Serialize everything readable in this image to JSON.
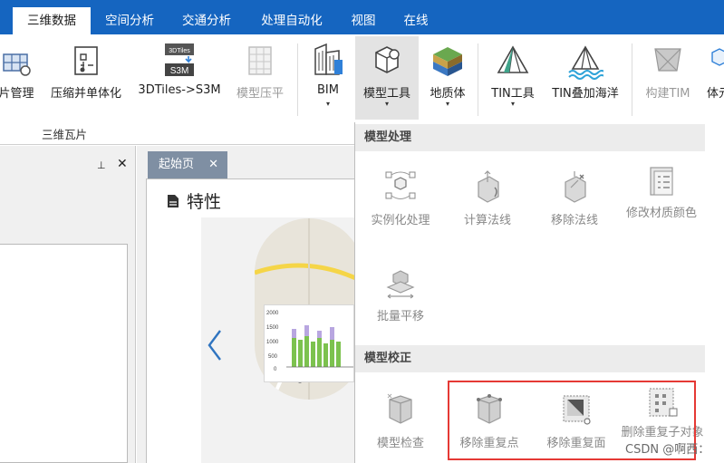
{
  "tabs": [
    {
      "label": "三维数据",
      "active": true
    },
    {
      "label": "空间分析",
      "active": false
    },
    {
      "label": "交通分析",
      "active": false
    },
    {
      "label": "处理自动化",
      "active": false
    },
    {
      "label": "视图",
      "active": false
    },
    {
      "label": "在线",
      "active": false
    }
  ],
  "ribbon": {
    "buttons": [
      {
        "label": "片管理",
        "icon": "tile-manage-icon",
        "disabled": false
      },
      {
        "label": "压缩并单体化",
        "icon": "compress-monomer-icon",
        "disabled": false
      },
      {
        "label": "3DTiles->S3M",
        "icon": "3dtiles-s3m-icon",
        "disabled": false,
        "icon_text": [
          "3DTiles",
          "S3M"
        ]
      },
      {
        "label": "模型压平",
        "icon": "model-flatten-icon",
        "disabled": true
      },
      {
        "label": "BIM",
        "icon": "bim-building-icon",
        "disabled": false,
        "dropdown": true
      },
      {
        "label": "模型工具",
        "icon": "model-tools-icon",
        "disabled": false,
        "dropdown": true,
        "selected": true
      },
      {
        "label": "地质体",
        "icon": "geology-body-icon",
        "disabled": false,
        "dropdown": true
      },
      {
        "label": "TIN工具",
        "icon": "tin-tools-icon",
        "disabled": false,
        "dropdown": true
      },
      {
        "label": "TIN叠加海洋",
        "icon": "tin-ocean-icon",
        "disabled": false
      },
      {
        "label": "构建TIM",
        "icon": "build-tim-icon",
        "disabled": true
      },
      {
        "label": "体元",
        "icon": "voxel-icon",
        "disabled": false
      }
    ],
    "group_label": "三维瓦片"
  },
  "left_panel": {
    "pin_glyph": "⊥",
    "close_glyph": "✕"
  },
  "document": {
    "tab_label": "起始页",
    "tab_close": "✕",
    "section_title": "特性",
    "chart_ticks": [
      "2000",
      "1500",
      "1000",
      "500",
      "0"
    ]
  },
  "dropdown": {
    "sections": [
      {
        "title": "模型处理",
        "items": [
          {
            "label": "实例化处理",
            "icon": "instancing-icon"
          },
          {
            "label": "计算法线",
            "icon": "compute-normals-icon"
          },
          {
            "label": "移除法线",
            "icon": "remove-normals-icon"
          },
          {
            "label": "修改材质颜色",
            "icon": "modify-material-color-icon"
          },
          {
            "label": "批量平移",
            "icon": "batch-translate-icon"
          }
        ]
      },
      {
        "title": "模型校正",
        "items": [
          {
            "label": "模型检查",
            "icon": "model-check-icon"
          },
          {
            "label": "移除重复点",
            "icon": "remove-duplicate-points-icon"
          },
          {
            "label": "移除重复面",
            "icon": "remove-duplicate-faces-icon"
          },
          {
            "label": "删除重复子对象",
            "icon": "delete-duplicate-subobjects-icon"
          }
        ]
      }
    ]
  },
  "watermark": "CSDN @啊西：",
  "colors": {
    "tab_bar": "#1565c0",
    "highlight": "#e53935",
    "selected_bg": "#e3e3e3"
  }
}
